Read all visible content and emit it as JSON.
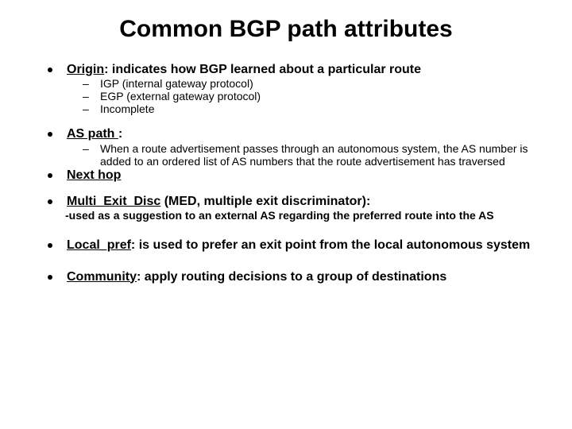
{
  "title": "Common BGP path attributes",
  "items": [
    {
      "label": "Origin",
      "desc": ": indicates how BGP learned about a particular route",
      "subs": [
        "IGP (internal gateway protocol)",
        "EGP (external gateway protocol)",
        "Incomplete"
      ]
    },
    {
      "label": "AS path ",
      "desc": ":",
      "subs": [
        "When a route advertisement passes through an autonomous system, the AS number is added to an ordered list of AS numbers that the route advertisement has traversed"
      ]
    },
    {
      "label": "Next hop",
      "desc": ""
    },
    {
      "label": "Multi_Exit_Disc",
      "desc": " (MED, multiple exit discriminator):",
      "note": "-used as a suggestion to an external AS regarding the preferred route into the AS"
    },
    {
      "label": "Local_pref",
      "desc": ":  is used to prefer an exit point from the local autonomous system"
    },
    {
      "label": "Community",
      "desc": ": apply routing decisions to a group of destinations"
    }
  ]
}
